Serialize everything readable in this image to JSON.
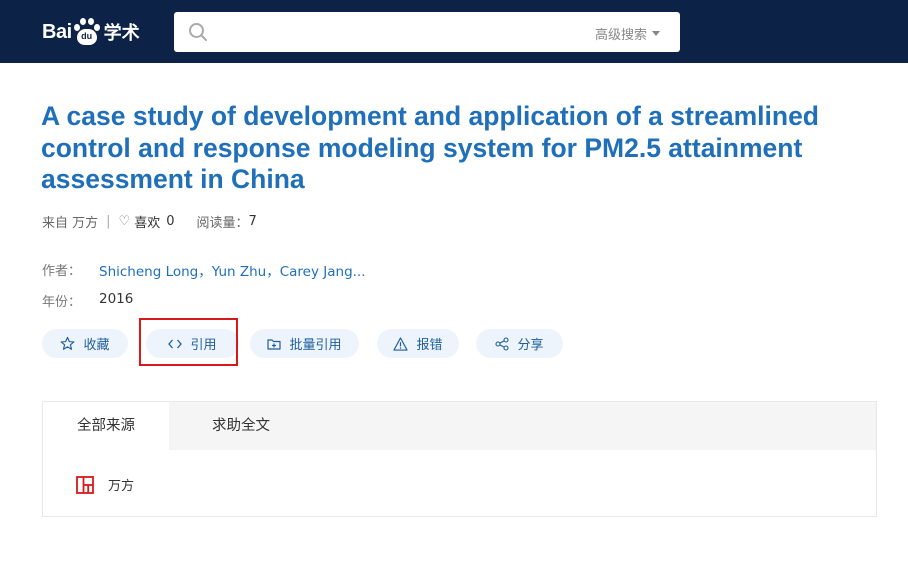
{
  "header": {
    "logo_text_left": "Bai",
    "logo_paw_text": "du",
    "logo_text_right": "学术",
    "search_placeholder": "",
    "advanced_search_label": "高级搜索"
  },
  "paper": {
    "title": "A case study of development and application of a streamlined control and response modeling system for PM2.5 attainment assessment in China",
    "source_label": "来自 万方",
    "likes_label": "喜欢",
    "likes_count": "0",
    "reads_label": "阅读量：",
    "reads_count": "7",
    "authors_label": "作者：",
    "authors": [
      "Shicheng Long，",
      "Yun Zhu，",
      "Carey Jang..."
    ],
    "year_label": "年份：",
    "year": "2016"
  },
  "actions": {
    "favorite": "收藏",
    "cite": "引用",
    "batch_cite": "批量引用",
    "report_error": "报错",
    "share": "分享"
  },
  "sources_panel": {
    "tabs": [
      "全部来源",
      "求助全文"
    ],
    "active_tab": 0,
    "items": [
      {
        "name": "万方",
        "icon": "wanfang-icon",
        "color": "#d7191c"
      }
    ]
  },
  "colors": {
    "header_bg": "#0c2246",
    "title": "#1f6fb9",
    "button_bg": "#edf4fb",
    "highlight_border": "#d7191c"
  }
}
